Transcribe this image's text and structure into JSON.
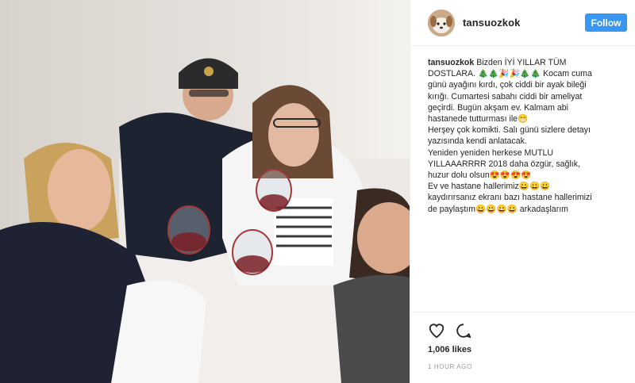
{
  "post": {
    "username": "tansuozkok",
    "follow_label": "Follow",
    "caption_lines": [
      "Bizden İYİ YILLAR TÜM",
      "DOSTLARA. 🎄🎄🎉🎉🎄🎄 Kocam cuma",
      "günü ayağını kırdı, çok ciddi bir ayak bileği",
      "kırığı. Cumartesi sabahı ciddi bir ameliyat",
      "geçirdi. Bugün akşam ev. Kalmam abi",
      "hastanede tutturması ile😁",
      "Herşey çok komikti. Salı günü sizlere detayı",
      "yazısında kendi anlatacak.",
      "Yeniden yeniden herkese MUTLU",
      "YILLAAARRRR 2018 daha özgür, sağlık,",
      "huzur dolu olsun😍😍😍😍",
      "Ev ve hastane hallerimiz😀😀😀",
      "kaydırırsanız ekranı bazı hastane hallerimizi",
      "de paylaştım😀😀😀😀 arkadaşlarım"
    ],
    "likes": "1,006 likes",
    "timestamp": "1 HOUR AGO"
  },
  "icons": {
    "like": "heart-outline-icon",
    "comment": "comment-bubble-icon"
  },
  "colors": {
    "follow_button": "#3897f0",
    "text": "#262626",
    "muted": "#999999",
    "border": "#efefef"
  }
}
